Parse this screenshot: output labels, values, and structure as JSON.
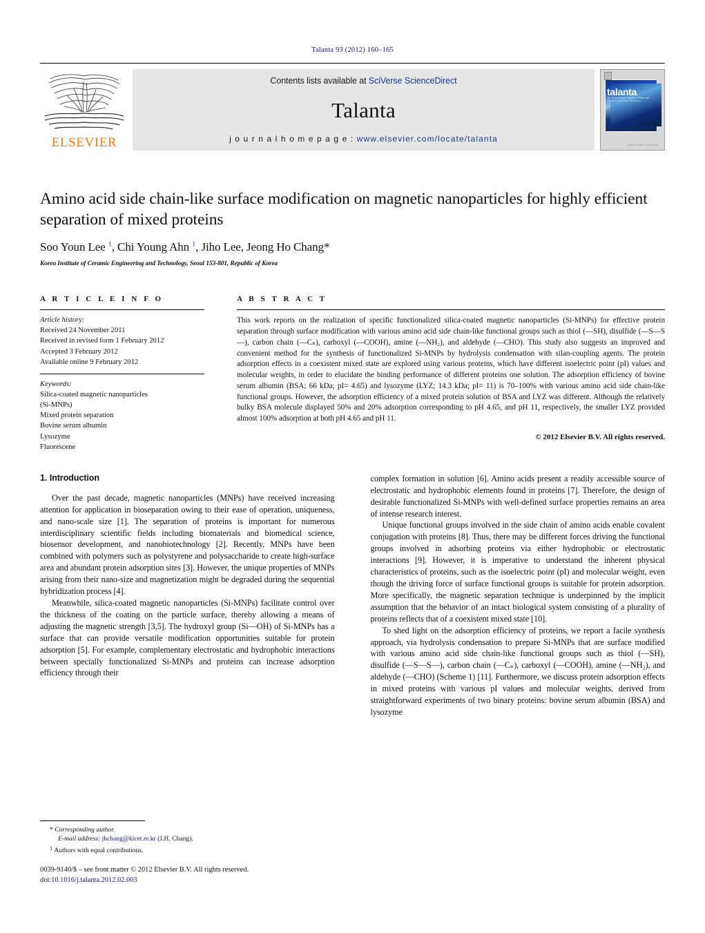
{
  "running_head": "Talanta 93 (2012) 160–165",
  "masthead": {
    "publisher_name": "ELSEVIER",
    "contents_prefix": "Contents lists available at ",
    "contents_link": "SciVerse ScienceDirect",
    "journal_name": "Talanta",
    "homepage_prefix": "j o u r n a l   h o m e p a g e :  ",
    "homepage_url": "www.elsevier.com/locate/talanta",
    "cover": {
      "title": "talanta",
      "subtitle": "The International Journal of Pure and Applied Analytical Chemistry",
      "bottom_logo": "Available online at\nScienceDirect"
    }
  },
  "article": {
    "title": "Amino acid side chain-like surface modification on magnetic nanoparticles for highly efficient separation of mixed proteins",
    "authors_html": "Soo Youn Lee ¹, Chi Young Ahn ¹, Jiho Lee, Jeong Ho Chang*",
    "affiliation": "Korea Institute of Ceramic Engineering and Technology, Seoul 153-801, Republic of Korea"
  },
  "article_info": {
    "heading": "A R T I C L E   I N F O",
    "history_label": "Article history:",
    "history": [
      "Received 24 November 2011",
      "Received in revised form 1 February 2012",
      "Accepted 3 February 2012",
      "Available online 9 February 2012"
    ],
    "keywords_label": "Keywords:",
    "keywords": [
      "Silica-coated magnetic nanoparticles",
      "(Si-MNPs)",
      "Mixed protein separation",
      "Bovine serum albumin",
      "Lysozyme",
      "Fluorescene"
    ]
  },
  "abstract": {
    "heading": "A B S T R A C T",
    "text": "This work reports on the realization of specific functionalized silica-coated magnetic nanoparticles (Si-MNPs) for effective protein separation through surface modification with various amino acid side chain-like functional groups such as thiol (—SH), disulfide (—S—S—), carbon chain (—Cₙ), carboxyl (—COOH), amine (—NH₂), and aldehyde (—CHO). This study also suggests an improved and convenient method for the synthesis of functionalized Si-MNPs by hydrolysis condensation with silan-coupling agents. The protein adsorption effects in a coexistent mixed state are explored using various proteins, which have different isoelectric point (pI) values and molecular weights, in order to elucidate the binding performance of different proteins one solution. The adsorption efficiency of bovine serum albumin (BSA; 66 kDa; pI= 4.65) and lysozyme (LYZ; 14.3 kDa; pI= 11) is 70–100% with various amino acid side chain-like functional groups. However, the adsorption efficiency of a mixed protein solution of BSA and LYZ was different. Although the relatively bulky BSA molecule displayed 50% and 20% adsorption corresponding to pH 4.65, and pH 11, respectively, the smaller LYZ provided almost 100% adsorption at both pH 4.65 and pH 11.",
    "copyright": "© 2012 Elsevier B.V. All rights reserved."
  },
  "body": {
    "section_number_title": "1.  Introduction",
    "left_paragraphs": [
      "Over the past decade, magnetic nanoparticles (MNPs) have received increasing attention for application in bioseparation owing to their ease of operation, uniqueness, and nano-scale size [1]. The separation of proteins is important for numerous interdisciplinary scientific fields including biomaterials and biomedical science, biosensor development, and nanobiotechnology [2]. Recently, MNPs have been combined with polymers such as polystyrene and polysaccharide to create high-surface area and abundant protein adsorption sites [3]. However, the unique properties of MNPs arising from their nano-size and magnetization might be degraded during the sequential hybridization process [4].",
      "Meanwhile, silica-coated magnetic nanoparticles (Si-MNPs) facilitate control over the thickness of the coating on the particle surface, thereby allowing a means of adjusting the magnetic strength [3,5]. The hydroxyl group (Si—OH) of Si-MNPs has a surface that can provide versatile modification opportunities suitable for protein adsorption [5]. For example, complementary electrostatic and hydrophobic interactions between specially functionalized Si-MNPs and proteins can increase adsorption efficiency through their"
    ],
    "right_paragraphs": [
      "complex formation in solution [6]. Amino acids present a readily accessible source of electrostatic and hydrophobic elements found in proteins [7]. Therefore, the design of desirable functionalized Si-MNPs with well-defined surface properties remains an area of intense research interest.",
      "Unique functional groups involved in the side chain of amino acids enable covalent conjugation with proteins [8]. Thus, there may be different forces driving the functional groups involved in adsorbing proteins via either hydrophobic or electrostatic interactions [9]. However, it is imperative to understand the inherent physical characteristics of proteins, such as the isoelectric point (pI) and molecular weight, even though the driving force of surface functional groups is suitable for protein adsorption. More specifically, the magnetic separation technique is underpinned by the implicit assumption that the behavior of an intact biological system consisting of a plurality of proteins reflects that of a coexistent mixed state [10].",
      "To shed light on the adsorption efficiency of proteins, we report a facile synthesis approach, via hydrolysis condensation to prepare Si-MNPs that are surface modified with various amino acid side chain-like functional groups such as thiol (—SH), disulfide (—S—S—), carbon chain (—Cₙ), carboxyl (—COOH), amine (—NH₂), and aldehyde (—CHO) (Scheme 1) [11]. Furthermore, we discuss protein adsorption effects in mixed proteins with various pI values and molecular weights, derived from straightforward experiments of two binary proteins: bovine serum albumin (BSA) and lysozyme"
    ]
  },
  "footnotes": {
    "corresponding": "Corresponding author.",
    "email_label": "E-mail address:",
    "email": "jhchang@kicet.re.kr",
    "email_suffix": "(J.H. Chang).",
    "equal_contrib": "Authors with equal contributions.",
    "issn_line": "0039-9140/$ – see front matter © 2012 Elsevier B.V. All rights reserved.",
    "doi_label": "doi:",
    "doi": "10.1016/j.talanta.2012.02.003"
  },
  "colors": {
    "link_blue": "#1b3a8f",
    "elsevier_orange": "#ef7c1a",
    "band_gray": "#e6e6e6"
  }
}
